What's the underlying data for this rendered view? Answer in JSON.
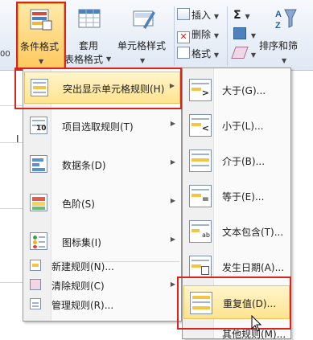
{
  "ribbon": {
    "conditional_format": "条件格式",
    "format_as_table_1": "套用",
    "format_as_table_2": "表格格式",
    "cell_styles": "单元格样式",
    "insert": "插入",
    "delete": "删除",
    "format": "格式",
    "sum_symbol": "Σ",
    "sort_filter": "排序和筛",
    "left_edge_num": "00",
    "cell_i": "I"
  },
  "left_menu": {
    "items": [
      {
        "label": "突出显示单元格规则(H)"
      },
      {
        "label": "项目选取规则(T)"
      },
      {
        "label": "数据条(D)"
      },
      {
        "label": "色阶(S)"
      },
      {
        "label": "图标集(I)"
      }
    ],
    "small_items": [
      {
        "label": "新建规则(N)..."
      },
      {
        "label": "清除规则(C)"
      },
      {
        "label": "管理规则(R)..."
      }
    ],
    "icon_number": "10"
  },
  "right_menu": {
    "items": [
      {
        "label": "大于(G)..."
      },
      {
        "label": "小于(L)..."
      },
      {
        "label": "介于(B)..."
      },
      {
        "label": "等于(E)..."
      },
      {
        "label": "文本包含(T)..."
      },
      {
        "label": "发生日期(A)..."
      },
      {
        "label": "重复值(D)..."
      },
      {
        "label": "其他规则(M)..."
      }
    ],
    "icon_ab": "ab"
  },
  "colors": {
    "highlight": "#ffe38f",
    "red_box": "#d9251d"
  }
}
